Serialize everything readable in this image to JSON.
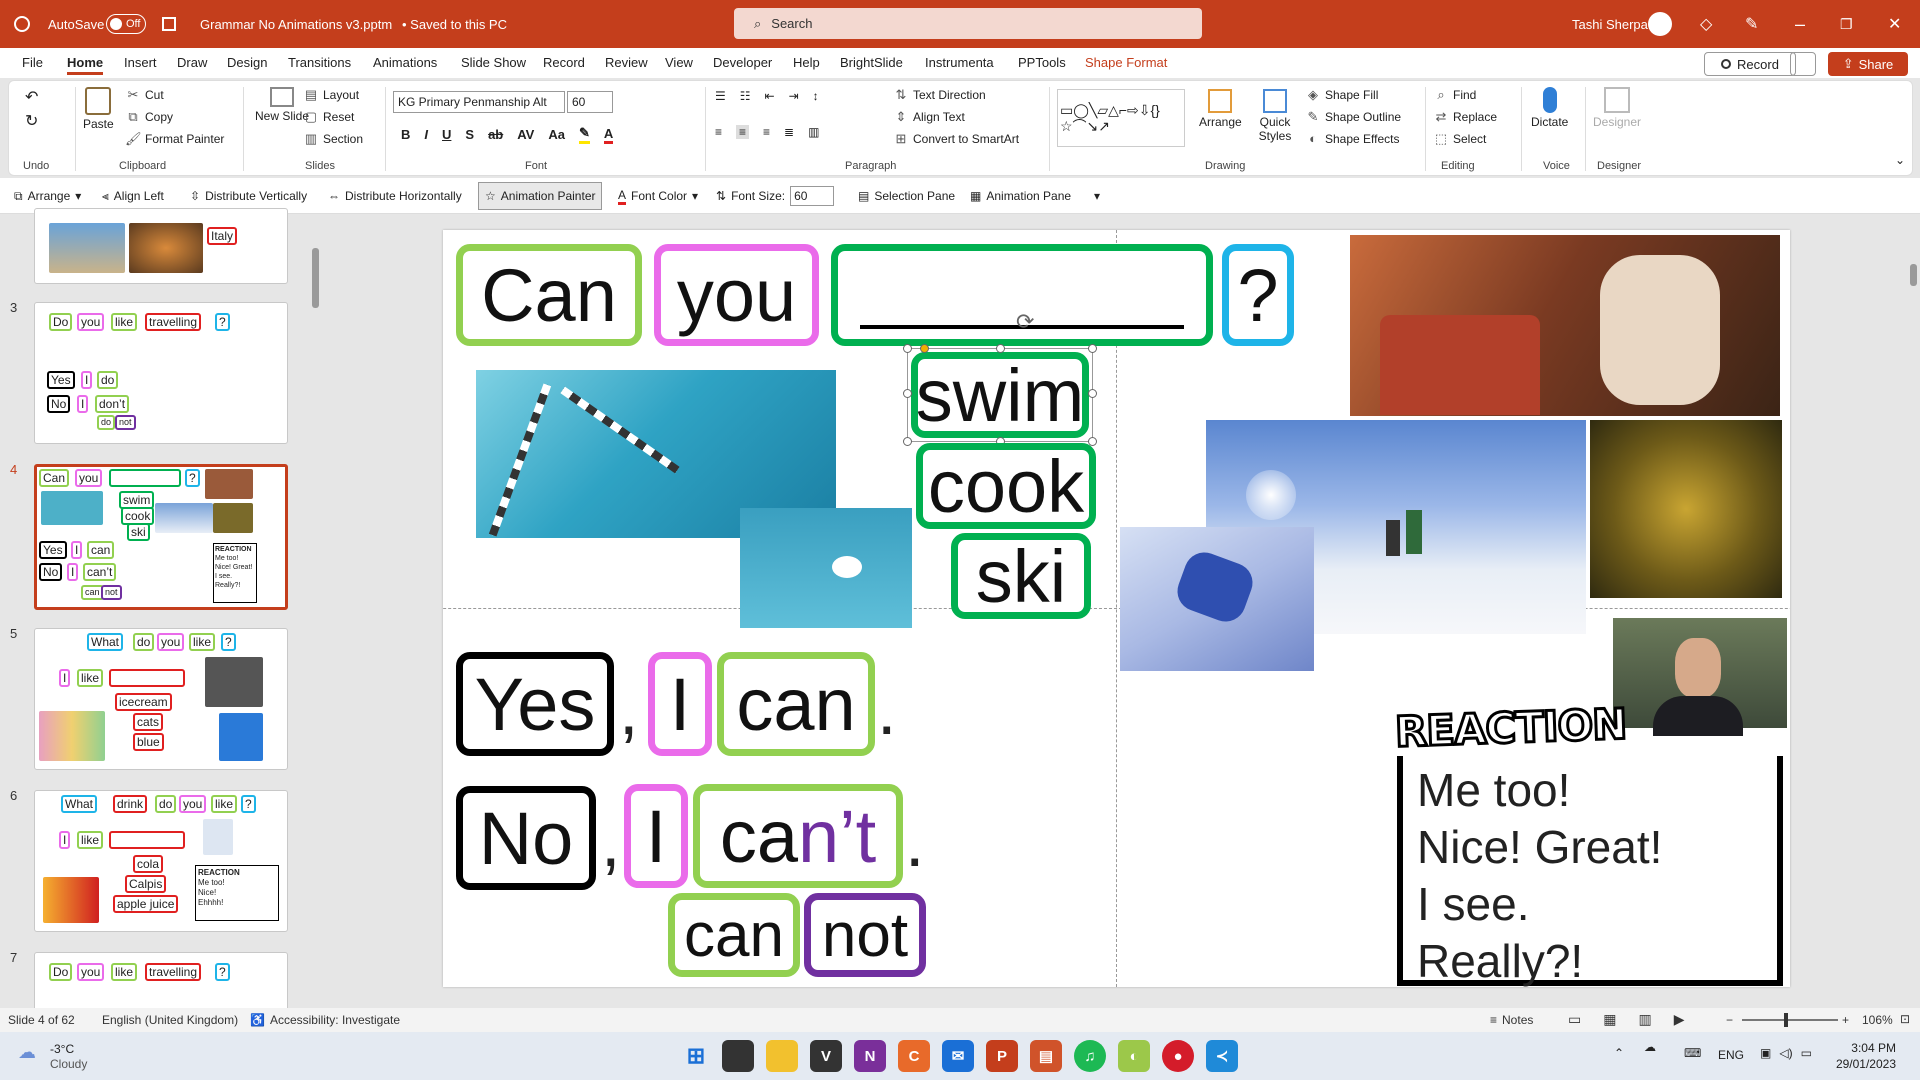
{
  "titlebar": {
    "autosave": "AutoSave",
    "autosave_state": "Off",
    "filename": "Grammar No Animations v3.pptm",
    "saved": "• Saved to this PC",
    "search_placeholder": "Search",
    "user": "Tashi Sherpa"
  },
  "tabs": [
    "File",
    "Home",
    "Insert",
    "Draw",
    "Design",
    "Transitions",
    "Animations",
    "Slide Show",
    "Record",
    "Review",
    "View",
    "Developer",
    "Help",
    "BrightSlide",
    "Instrumenta",
    "PPTools",
    "Shape Format"
  ],
  "record_btn": "Record",
  "share_btn": "Share",
  "ribbon": {
    "undo_label": "Undo",
    "clipboard": {
      "paste": "Paste",
      "cut": "Cut",
      "copy": "Copy",
      "format_painter": "Format Painter",
      "label": "Clipboard"
    },
    "slides": {
      "new_slide": "New Slide",
      "layout": "Layout",
      "reset": "Reset",
      "section": "Section",
      "label": "Slides"
    },
    "font": {
      "name": "KG Primary Penmanship Alt",
      "size": "60",
      "label": "Font"
    },
    "paragraph": {
      "text_direction": "Text Direction",
      "align_text": "Align Text",
      "smartart": "Convert to SmartArt",
      "label": "Paragraph"
    },
    "drawing": {
      "arrange": "Arrange",
      "quick_styles": "Quick Styles",
      "fill": "Shape Fill",
      "outline": "Shape Outline",
      "effects": "Shape Effects",
      "label": "Drawing"
    },
    "editing": {
      "find": "Find",
      "replace": "Replace",
      "select": "Select",
      "label": "Editing"
    },
    "voice": {
      "dictate": "Dictate",
      "label": "Voice"
    },
    "designer": {
      "designer": "Designer",
      "label": "Designer"
    }
  },
  "qat": {
    "arrange": "Arrange",
    "align_left": "Align Left",
    "dist_v": "Distribute Vertically",
    "dist_h": "Distribute Horizontally",
    "anim_painter": "Animation Painter",
    "font_color": "Font Color",
    "font_size_label": "Font Size:",
    "font_size": "60",
    "selection_pane": "Selection Pane",
    "animation_pane": "Animation Pane"
  },
  "thumbs": {
    "t2": {
      "word": "Italy"
    },
    "t3": {
      "num": "3",
      "q": [
        "Do",
        "you",
        "like",
        "travelling",
        "?"
      ],
      "a1": [
        "Yes",
        ",",
        "I",
        "do",
        "."
      ],
      "a2": [
        "No",
        ",",
        "I",
        "don’t",
        "."
      ],
      "a3": [
        "do",
        "not"
      ]
    },
    "t4": {
      "num": "4",
      "q": [
        "Can",
        "you",
        "",
        "?"
      ],
      "verbs": [
        "swim",
        "cook",
        "ski"
      ],
      "a1": [
        "Yes",
        "I",
        "can"
      ],
      "a2": [
        "No",
        "I",
        "can’t"
      ],
      "a3": [
        "can",
        "not"
      ],
      "reaction": "REACTION",
      "rlines": [
        "Me too!",
        "Nice! Great!",
        "I see.",
        "Really?!"
      ]
    },
    "t5": {
      "num": "5",
      "q": [
        "What",
        "do",
        "you",
        "like",
        "?"
      ],
      "i": "I",
      "like": "like",
      "opts": [
        "icecream",
        "cats",
        "blue"
      ]
    },
    "t6": {
      "num": "6",
      "q": [
        "What",
        "drink",
        "do",
        "you",
        "like",
        "?"
      ],
      "i": "I",
      "like": "like",
      "opts": [
        "cola",
        "Calpis",
        "apple juice"
      ],
      "reaction": "REACTION",
      "rlines": [
        "Me too!",
        "Nice!",
        "Ehhhh!"
      ]
    },
    "t7": {
      "num": "7",
      "q": [
        "Do",
        "you",
        "like",
        "travelling",
        "?"
      ]
    }
  },
  "slide": {
    "q": [
      "Can",
      "you",
      "?"
    ],
    "verbs": [
      "swim",
      "cook",
      "ski"
    ],
    "yes": "Yes",
    "i": "I",
    "can": "can",
    "no": "No",
    "cant_a": "ca",
    "cant_b": "n’t",
    "split_can": "can",
    "split_not": "not",
    "comma": ",",
    "period": ".",
    "reaction_title": "REACTION",
    "reaction_lines": [
      "Me too!",
      "Nice! Great!",
      "I see.",
      "Really?!"
    ]
  },
  "statusbar": {
    "slide": "Slide 4 of 62",
    "lang": "English (United Kingdom)",
    "access": "Accessibility: Investigate",
    "notes": "Notes",
    "zoom": "106%"
  },
  "taskbar": {
    "temp": "-3°C",
    "weather": "Cloudy",
    "lang": "ENG",
    "time": "3:04 PM",
    "date": "29/01/2023"
  },
  "colors": {
    "accent": "#c43e1c",
    "green": "#00b050",
    "lime": "#92d050",
    "pink": "#ea6bea",
    "blue": "#1eb4e8",
    "purple": "#7030a0",
    "red": "#e02020",
    "black": "#000000"
  }
}
